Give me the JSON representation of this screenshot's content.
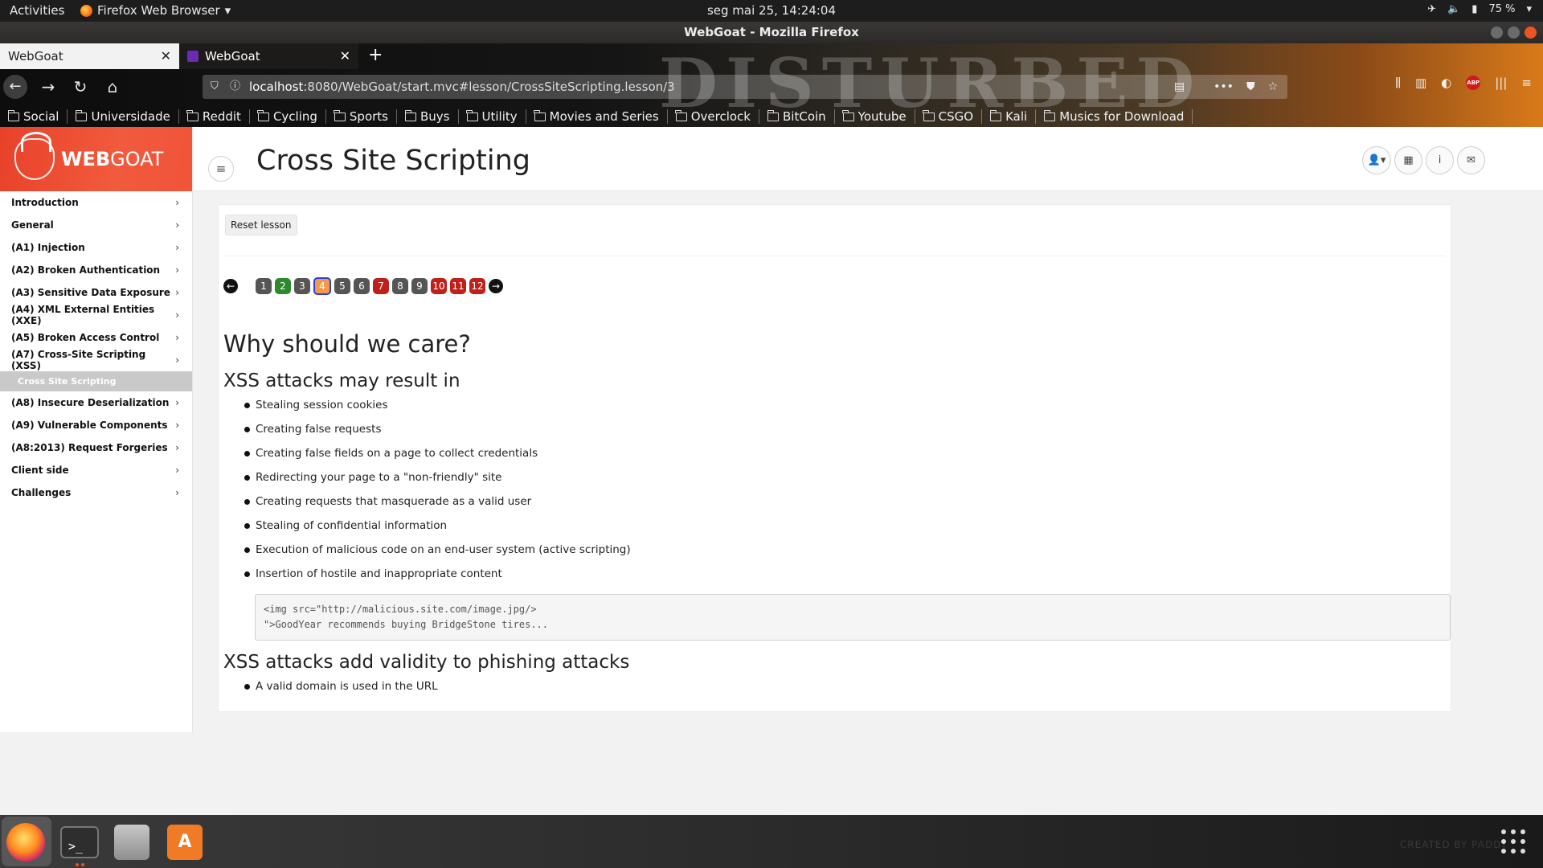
{
  "system_bar": {
    "activities": "Activities",
    "app_name": "Firefox Web Browser",
    "clock": "seg mai 25, 14:24:04",
    "battery": "75 %"
  },
  "window": {
    "title": "WebGoat - Mozilla Firefox"
  },
  "tabs": [
    {
      "label": "WebGoat",
      "active": true
    },
    {
      "label": "WebGoat",
      "active": false
    }
  ],
  "browser": {
    "url_host": "localhost",
    "url_rest": ":8080/WebGoat/start.mvc#lesson/CrossSiteScripting.lesson/3",
    "banner_text": "DISTURBED"
  },
  "bookmarks": [
    "Social",
    "Universidade",
    "Reddit",
    "Cycling",
    "Sports",
    "Buys",
    "Utility",
    "Movies and Series",
    "Overclock",
    "BitCoin",
    "Youtube",
    "CSGO",
    "Kali",
    "Musics for Download"
  ],
  "app": {
    "logo_bold": "WEB",
    "logo_rest": "GOAT",
    "page_title": "Cross Site Scripting"
  },
  "sidebar": {
    "items": [
      "Introduction",
      "General",
      "(A1) Injection",
      "(A2) Broken Authentication",
      "(A3) Sensitive Data Exposure",
      "(A4) XML External Entities (XXE)",
      "(A5) Broken Access Control",
      "(A7) Cross-Site Scripting (XSS)",
      "(A8) Insecure Deserialization",
      "(A9) Vulnerable Components",
      "(A8:2013) Request Forgeries",
      "Client side",
      "Challenges"
    ],
    "active_sub": "Cross Site Scripting"
  },
  "lesson": {
    "reset_label": "Reset lesson",
    "pages": [
      "1",
      "2",
      "3",
      "4",
      "5",
      "6",
      "7",
      "8",
      "9",
      "10",
      "11",
      "12"
    ],
    "current_page": "4",
    "heading": "Why should we care?",
    "subheading1": "XSS attacks may result in",
    "bullets1": [
      "Stealing session cookies",
      "Creating false requests",
      "Creating false fields on a page to collect credentials",
      "Redirecting your page to a \"non-friendly\" site",
      "Creating requests that masquerade as a valid user",
      "Stealing of confidential information",
      "Execution of malicious code on an end-user system (active scripting)",
      "Insertion of hostile and inappropriate content"
    ],
    "code_line1": "<img src=\"http://malicious.site.com/image.jpg/>",
    "code_line2": "\">GoodYear recommends buying BridgeStone tires...",
    "subheading2": "XSS attacks add validity to phishing attacks",
    "bullets2": [
      "A valid domain is used in the URL"
    ]
  },
  "colors": {
    "brand": "#f15a3c",
    "page_green": "#2c8a2c",
    "page_red": "#c0201a",
    "page_gray": "#555555",
    "page_current": "#f39a4a"
  },
  "dock": {
    "watermark": "CREATED BY PADDY"
  }
}
